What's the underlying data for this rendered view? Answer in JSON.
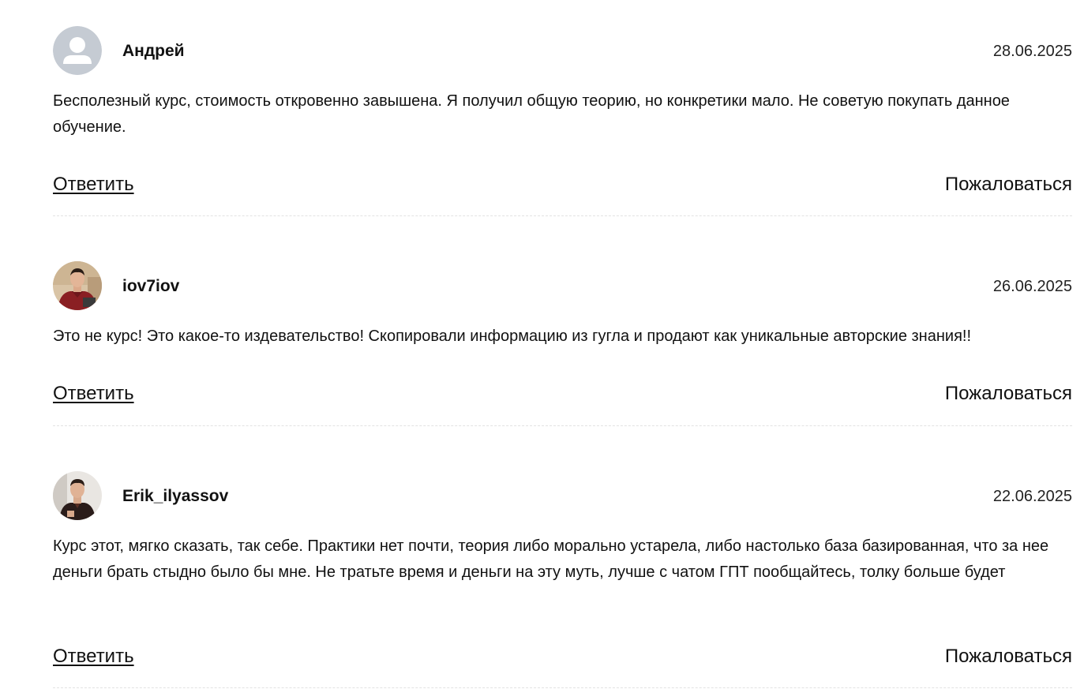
{
  "comments": [
    {
      "author": "Андрей",
      "date": "28.06.2025",
      "text": "Бесполезный курс, стоимость откровенно завышена. Я получил общую теорию, но конкретики мало. Не советую покупать данное обучение.",
      "reply_label": "Ответить",
      "report_label": "Пожаловаться",
      "avatar_icon": "default-user-avatar-icon"
    },
    {
      "author": "iov7iov",
      "date": "26.06.2025",
      "text": "Это не курс! Это какое-то издевательство! Скопировали информацию из гугла и продают как уникальные авторские знания!!",
      "reply_label": "Ответить",
      "report_label": "Пожаловаться",
      "avatar_icon": "user-photo-avatar"
    },
    {
      "author": "Erik_ilyassov",
      "date": "22.06.2025",
      "text": "Курс этот, мягко сказать, так себе. Практики нет почти, теория либо морально устарела, либо настолько база базированная, что за нее деньги брать стыдно было бы мне. Не тратьте время и деньги на эту муть, лучше с чатом ГПТ пообщайтесь, толку больше будет",
      "reply_label": "Ответить",
      "report_label": "Пожаловаться",
      "avatar_icon": "user-photo-avatar"
    }
  ],
  "colors": {
    "text": "#111111",
    "divider": "#e2e2e2",
    "default_avatar_bg": "#c5cbd3"
  }
}
